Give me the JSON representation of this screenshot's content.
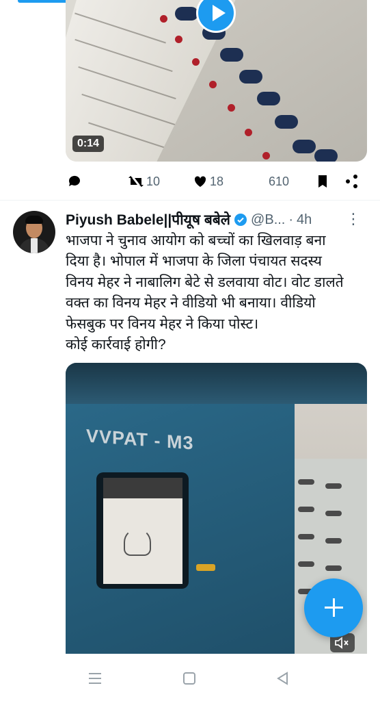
{
  "first_tweet": {
    "video_duration": "0:14",
    "retweets": "10",
    "likes": "18",
    "views": "610"
  },
  "tweet": {
    "author_name": "Piyush Babele||पीयूष बबेले",
    "handle": "@B...",
    "separator": "·",
    "time": "4h",
    "text_lines": [
      "भाजपा ने चुनाव आयोग को बच्चों का खिलवाड़ बना",
      "दिया है। भोपाल में भाजपा के जिला पंचायत सदस्य",
      "विनय मेहर ने नाबालिग बेटे से डलवाया वोट। वोट डालते",
      "वक्त का विनय मेहर ने वीडियो भी बनाया। वीडियो",
      "फेसबुक पर विनय मेहर ने किया पोस्ट।",
      "कोई कार्रवाई होगी?"
    ],
    "media_label": "VVPAT - M3"
  },
  "colors": {
    "accent": "#1d9bf0",
    "muted_text": "#536471"
  }
}
